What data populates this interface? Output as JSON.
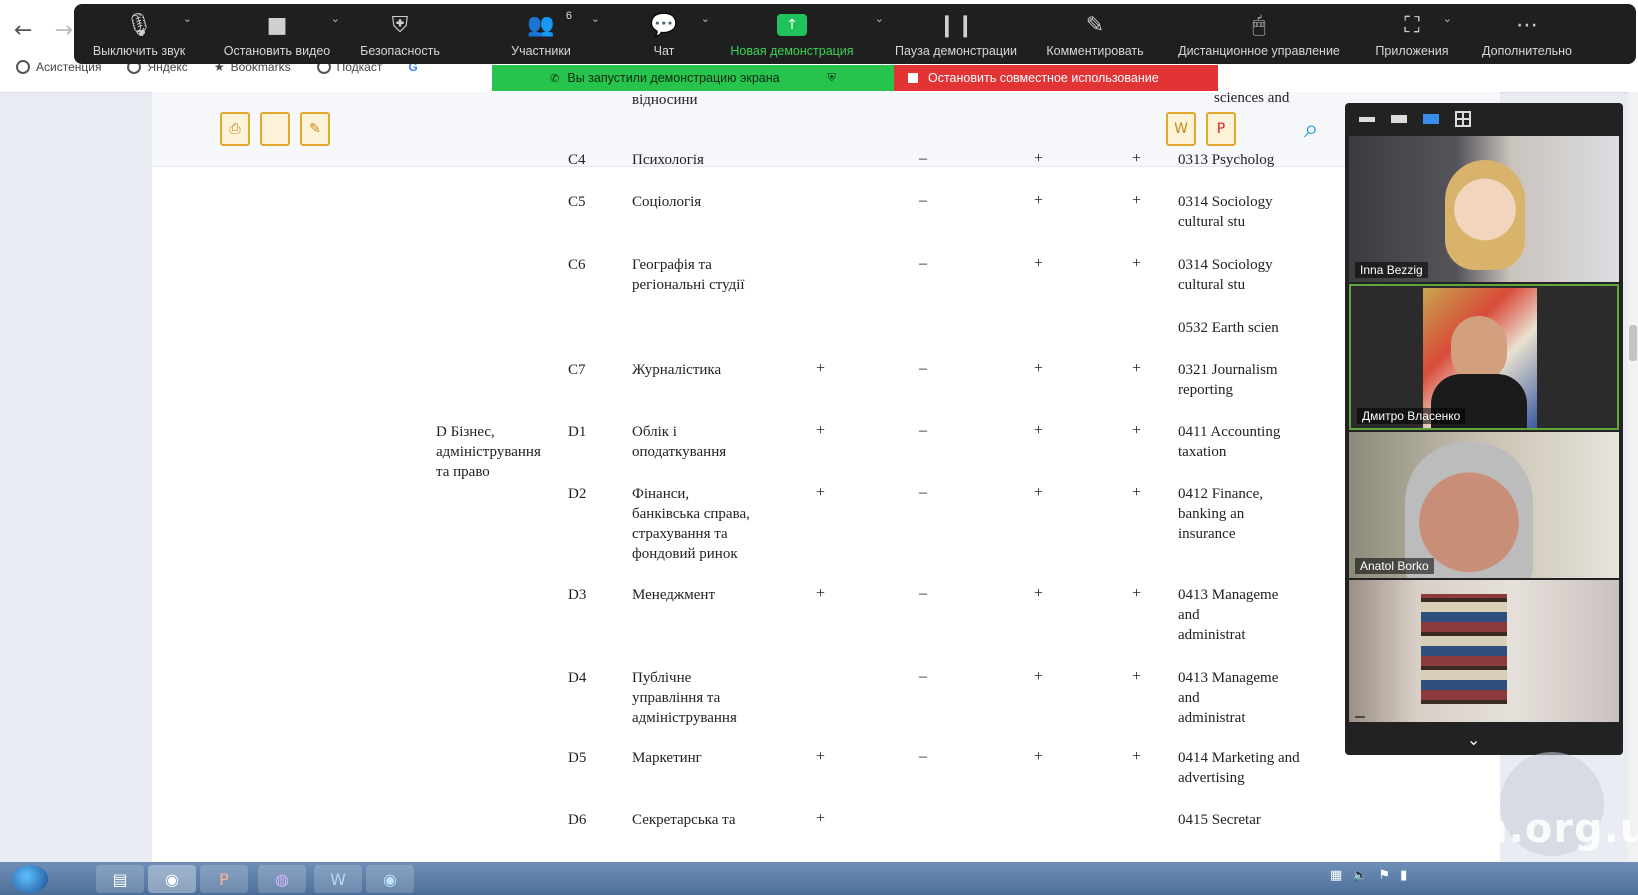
{
  "zoom_toolbar": {
    "audio": "Выключить звук",
    "video": "Остановить видео",
    "security": "Безопасность",
    "participants": "Участники",
    "participants_count": "6",
    "chat": "Чат",
    "new_share": "Новая демонстрация",
    "pause_share": "Пауза демонстрации",
    "annotate": "Комментировать",
    "remote_control": "Дистанционное управление",
    "apps": "Приложения",
    "more": "Дополнительно"
  },
  "share_banner": {
    "green": "Вы запустили демонстрацию экрана",
    "red": "Остановить совместное использование"
  },
  "bookmarks": [
    "Асистенция",
    "Яндекс",
    "Bookmarks",
    "Подкаст"
  ],
  "table": {
    "top_partial": "відносини",
    "top_right_partial": "sciences and",
    "rows": [
      {
        "code": "C4",
        "name": [
          "Психологія"
        ],
        "marks": [
          "",
          "–",
          "+",
          "+"
        ],
        "isced": [
          "0313 Psycholog"
        ]
      },
      {
        "code": "C5",
        "name": [
          "Соціологія"
        ],
        "marks": [
          "",
          "–",
          "+",
          "+"
        ],
        "isced": [
          "0314 Sociology",
          "cultural stu"
        ]
      },
      {
        "code": "C6",
        "name": [
          "Географія та",
          "регіональні студії"
        ],
        "marks": [
          "",
          "–",
          "+",
          "+"
        ],
        "isced": [
          "0314 Sociology",
          "cultural stu"
        ]
      },
      {
        "code": "",
        "name": [],
        "marks": [
          "",
          "",
          "",
          ""
        ],
        "isced": [
          "0532 Earth scien"
        ]
      },
      {
        "code": "C7",
        "name": [
          "Журналістика"
        ],
        "marks": [
          "+",
          "–",
          "+",
          "+"
        ],
        "isced": [
          "0321 Journalism",
          "reporting"
        ]
      },
      {
        "code": "D1",
        "name": [
          "Облік і",
          "оподаткування"
        ],
        "marks": [
          "+",
          "–",
          "+",
          "+"
        ],
        "isced": [
          "0411 Accounting",
          "taxation"
        ]
      },
      {
        "code": "D2",
        "name": [
          "Фінанси,",
          "банківська справа,",
          "страхування та",
          "фондовий ринок"
        ],
        "marks": [
          "+",
          "–",
          "+",
          "+"
        ],
        "isced": [
          "0412 Finance,",
          "banking an",
          "insurance"
        ]
      },
      {
        "code": "D3",
        "name": [
          "Менеджмент"
        ],
        "marks": [
          "+",
          "–",
          "+",
          "+"
        ],
        "isced": [
          "0413 Manageme",
          "and",
          "administrat"
        ]
      },
      {
        "code": "D4",
        "name": [
          "Публічне",
          "управління та",
          "адміністрування"
        ],
        "marks": [
          "",
          "–",
          "+",
          "+"
        ],
        "isced": [
          "0413 Manageme",
          "and",
          "administrat"
        ]
      },
      {
        "code": "D5",
        "name": [
          "Маркетинг"
        ],
        "marks": [
          "+",
          "–",
          "+",
          "+"
        ],
        "isced": [
          "0414 Marketing and",
          "advertising"
        ]
      },
      {
        "code": "D6",
        "name": [
          "Секретарська та"
        ],
        "marks": [
          "+",
          "",
          "",
          ""
        ],
        "isced": [
          "0415 Secretar"
        ]
      }
    ],
    "group_label": [
      "D Бізнес,",
      "адміністрування",
      "та право"
    ]
  },
  "participants": [
    {
      "name": "Inna Bezzig"
    },
    {
      "name": "Дмитро Власенко"
    },
    {
      "name": "Anatol Borko"
    },
    {
      "name": ""
    }
  ],
  "watermark": "mon.org.ua",
  "colors": {
    "zoom_bg": "#1f1f1f",
    "share_green": "#26c44d",
    "share_red": "#e23434",
    "accent_blue": "#1a9bd8"
  }
}
